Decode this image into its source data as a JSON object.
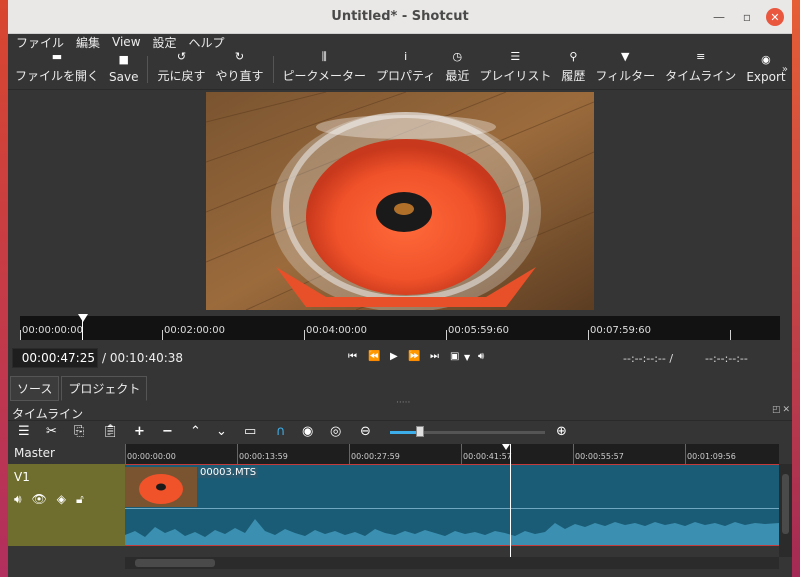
{
  "window": {
    "title": "Untitled* - Shotcut"
  },
  "menu": [
    "ファイル",
    "編集",
    "View",
    "設定",
    "ヘルプ"
  ],
  "toolbar": {
    "open": "ファイルを開く",
    "save": "Save",
    "undo": "元に戻す",
    "redo": "やり直す",
    "peak_meter": "ピークメーター",
    "properties": "プロパティ",
    "recent": "最近",
    "playlist": "プレイリスト",
    "history": "履歴",
    "filters": "フィルター",
    "timeline": "タイムライン",
    "export": "Export",
    "more": "»"
  },
  "ruler": {
    "labels": [
      "00:00:00:00",
      "00:02:00:00",
      "00:04:00:00",
      "00:05:59:60",
      "00:07:59:60"
    ]
  },
  "transport": {
    "current_time": "00:00:47:25",
    "total_time": "/ 00:10:40:38",
    "in_point": "--:--:--:-- /",
    "out_point": "--:--:--:--"
  },
  "tabs": {
    "source": "ソース",
    "project": "プロジェクト"
  },
  "dock": {
    "title": "タイムライン"
  },
  "timeline": {
    "master": "Master",
    "track": "V1",
    "clip_name": "00003.MTS",
    "ruler_labels": [
      "00:00:00:00",
      "00:00:13:59",
      "00:00:27:59",
      "00:00:41:57",
      "00:00:55:57",
      "00:01:09:56"
    ]
  }
}
